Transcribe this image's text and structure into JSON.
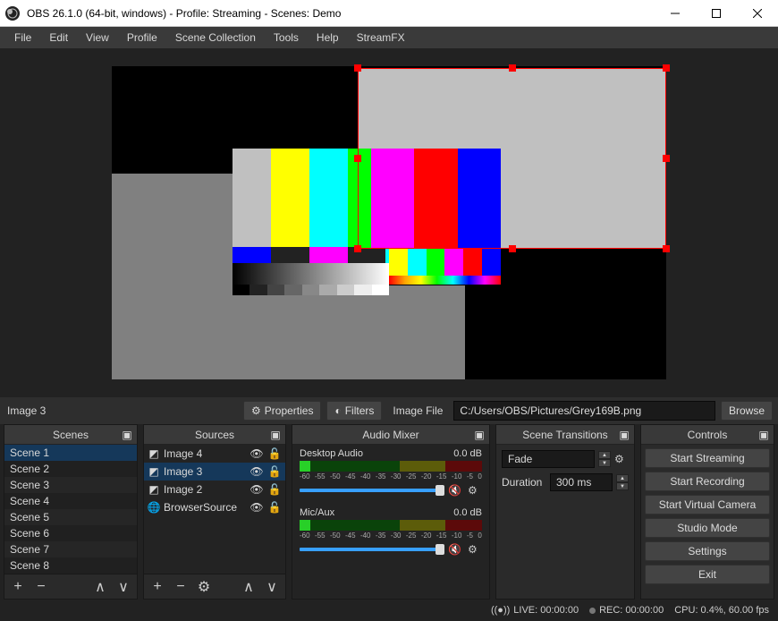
{
  "window": {
    "title": "OBS 26.1.0 (64-bit, windows) - Profile: Streaming - Scenes: Demo"
  },
  "menubar": [
    "File",
    "Edit",
    "View",
    "Profile",
    "Scene Collection",
    "Tools",
    "Help",
    "StreamFX"
  ],
  "toolbar": {
    "selected_source": "Image 3",
    "properties_label": "Properties",
    "filters_label": "Filters",
    "field_label": "Image File",
    "field_value": "C:/Users/OBS/Pictures/Grey169B.png",
    "browse_label": "Browse"
  },
  "panels": {
    "scenes_title": "Scenes",
    "sources_title": "Sources",
    "mixer_title": "Audio Mixer",
    "transitions_title": "Scene Transitions",
    "controls_title": "Controls"
  },
  "scenes": [
    "Scene 1",
    "Scene 2",
    "Scene 3",
    "Scene 4",
    "Scene 5",
    "Scene 6",
    "Scene 7",
    "Scene 8"
  ],
  "scenes_selected": 0,
  "sources": [
    {
      "name": "Image 4",
      "icon": "image",
      "visible": true,
      "locked": false,
      "selected": false
    },
    {
      "name": "Image 3",
      "icon": "image",
      "visible": true,
      "locked": false,
      "selected": true
    },
    {
      "name": "Image 2",
      "icon": "image",
      "visible": true,
      "locked": false,
      "selected": false
    },
    {
      "name": "BrowserSource",
      "icon": "globe",
      "visible": true,
      "locked": false,
      "selected": false
    }
  ],
  "mixer": {
    "ch1": {
      "name": "Desktop Audio",
      "db": "0.0 dB"
    },
    "ch2": {
      "name": "Mic/Aux",
      "db": "0.0 dB"
    },
    "ticks": [
      "-60",
      "-55",
      "-50",
      "-45",
      "-40",
      "-35",
      "-30",
      "-25",
      "-20",
      "-15",
      "-10",
      "-5",
      "0"
    ]
  },
  "transitions": {
    "selected": "Fade",
    "duration_label": "Duration",
    "duration_value": "300 ms"
  },
  "controls": [
    "Start Streaming",
    "Start Recording",
    "Start Virtual Camera",
    "Studio Mode",
    "Settings",
    "Exit"
  ],
  "status": {
    "live": "LIVE: 00:00:00",
    "rec": "REC: 00:00:00",
    "cpu": "CPU: 0.4%, 60.00 fps"
  }
}
